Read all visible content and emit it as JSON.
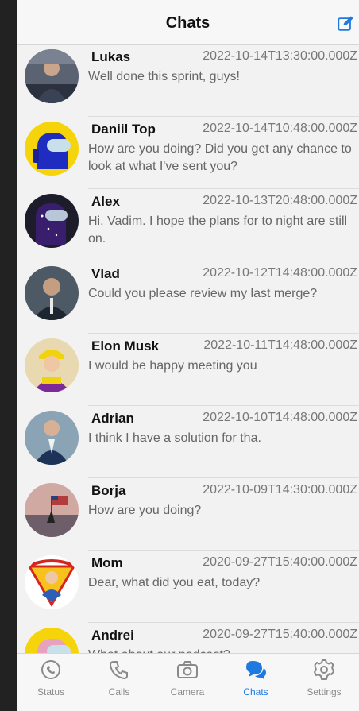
{
  "header": {
    "title": "Chats",
    "compose_icon": "compose-icon"
  },
  "chats": [
    {
      "name": "Lukas",
      "time": "2022-10-14T13:30:00.000Z",
      "message": "Well done this sprint, guys!"
    },
    {
      "name": "Daniil Top",
      "time": "2022-10-14T10:48:00.000Z",
      "message": "How are you doing? Did you get any chance to look at what I've sent you?"
    },
    {
      "name": "Alex",
      "time": "2022-10-13T20:48:00.000Z",
      "message": "Hi, Vadim. I hope the plans for to night are still on."
    },
    {
      "name": "Vlad",
      "time": "2022-10-12T14:48:00.000Z",
      "message": "Could you please review my last merge?"
    },
    {
      "name": "Elon Musk",
      "time": "2022-10-11T14:48:00.000Z",
      "message": "I would be happy meeting you"
    },
    {
      "name": "Adrian",
      "time": "2022-10-10T14:48:00.000Z",
      "message": "I think I have a solution for tha."
    },
    {
      "name": "Borja",
      "time": "2022-10-09T14:30:00.000Z",
      "message": "How are you doing?"
    },
    {
      "name": "Mom",
      "time": "2020-09-27T15:40:00.000Z",
      "message": "Dear, what did you eat, today?"
    },
    {
      "name": "Andrei",
      "time": "2020-09-27T15:40:00.000Z",
      "message": "What about our podcast?"
    }
  ],
  "tabs": [
    {
      "label": "Status",
      "icon": "status-icon"
    },
    {
      "label": "Calls",
      "icon": "phone-icon"
    },
    {
      "label": "Camera",
      "icon": "camera-icon"
    },
    {
      "label": "Chats",
      "icon": "chat-bubbles-icon",
      "active": true
    },
    {
      "label": "Settings",
      "icon": "gear-icon"
    }
  ],
  "colors": {
    "accent": "#1f7ae0",
    "background": "#f2f2f2"
  }
}
